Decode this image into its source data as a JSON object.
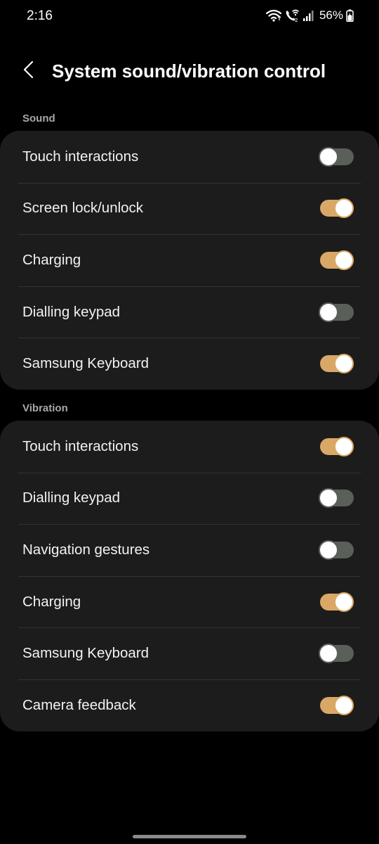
{
  "status_bar": {
    "time": "2:16",
    "battery_percent": "56%",
    "icons": [
      "wifi-icon",
      "wifi-calling-icon",
      "signal-icon",
      "battery-charging-icon"
    ]
  },
  "header": {
    "back_icon": "chevron-left-icon",
    "title": "System sound/vibration control"
  },
  "colors": {
    "background": "#000000",
    "card": "#1c1c1c",
    "toggle_on": "#d9a866",
    "toggle_off": "#5b5f59",
    "section_header": "#a8a8a8"
  },
  "sections": [
    {
      "title": "Sound",
      "items": [
        {
          "label": "Touch interactions",
          "enabled": false
        },
        {
          "label": "Screen lock/unlock",
          "enabled": true
        },
        {
          "label": "Charging",
          "enabled": true
        },
        {
          "label": "Dialling keypad",
          "enabled": false
        },
        {
          "label": "Samsung Keyboard",
          "enabled": true
        }
      ]
    },
    {
      "title": "Vibration",
      "items": [
        {
          "label": "Touch interactions",
          "enabled": true
        },
        {
          "label": "Dialling keypad",
          "enabled": false
        },
        {
          "label": "Navigation gestures",
          "enabled": false
        },
        {
          "label": "Charging",
          "enabled": true
        },
        {
          "label": "Samsung Keyboard",
          "enabled": false
        },
        {
          "label": "Camera feedback",
          "enabled": true
        }
      ]
    }
  ]
}
